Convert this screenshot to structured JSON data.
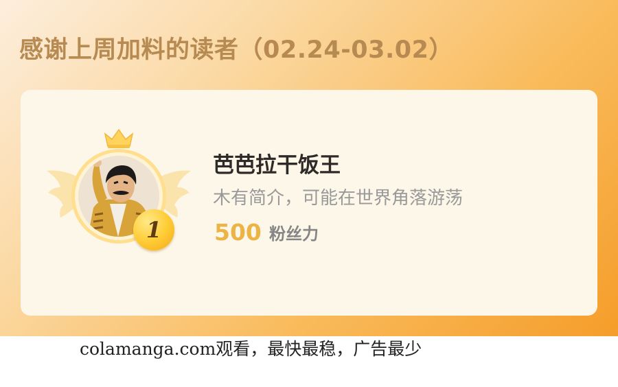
{
  "header": {
    "title": "感谢上周加料的读者（02.24-03.02）"
  },
  "reader_card": {
    "rank": "1",
    "name": "芭芭拉干饭王",
    "bio": "木有简介，可能在世界角落游荡",
    "fans_value": "500",
    "fans_unit": "粉丝力"
  },
  "footer": {
    "watermark": "colamanga.com观看，最快最稳，广告最少"
  },
  "colors": {
    "accent": "#f59d2a",
    "title": "#b78a52",
    "fans_value": "#ecb446",
    "card_bg": "#fcf7e9"
  },
  "icons": [
    "crown-icon",
    "wings-icon",
    "rank-medal-icon",
    "avatar"
  ]
}
